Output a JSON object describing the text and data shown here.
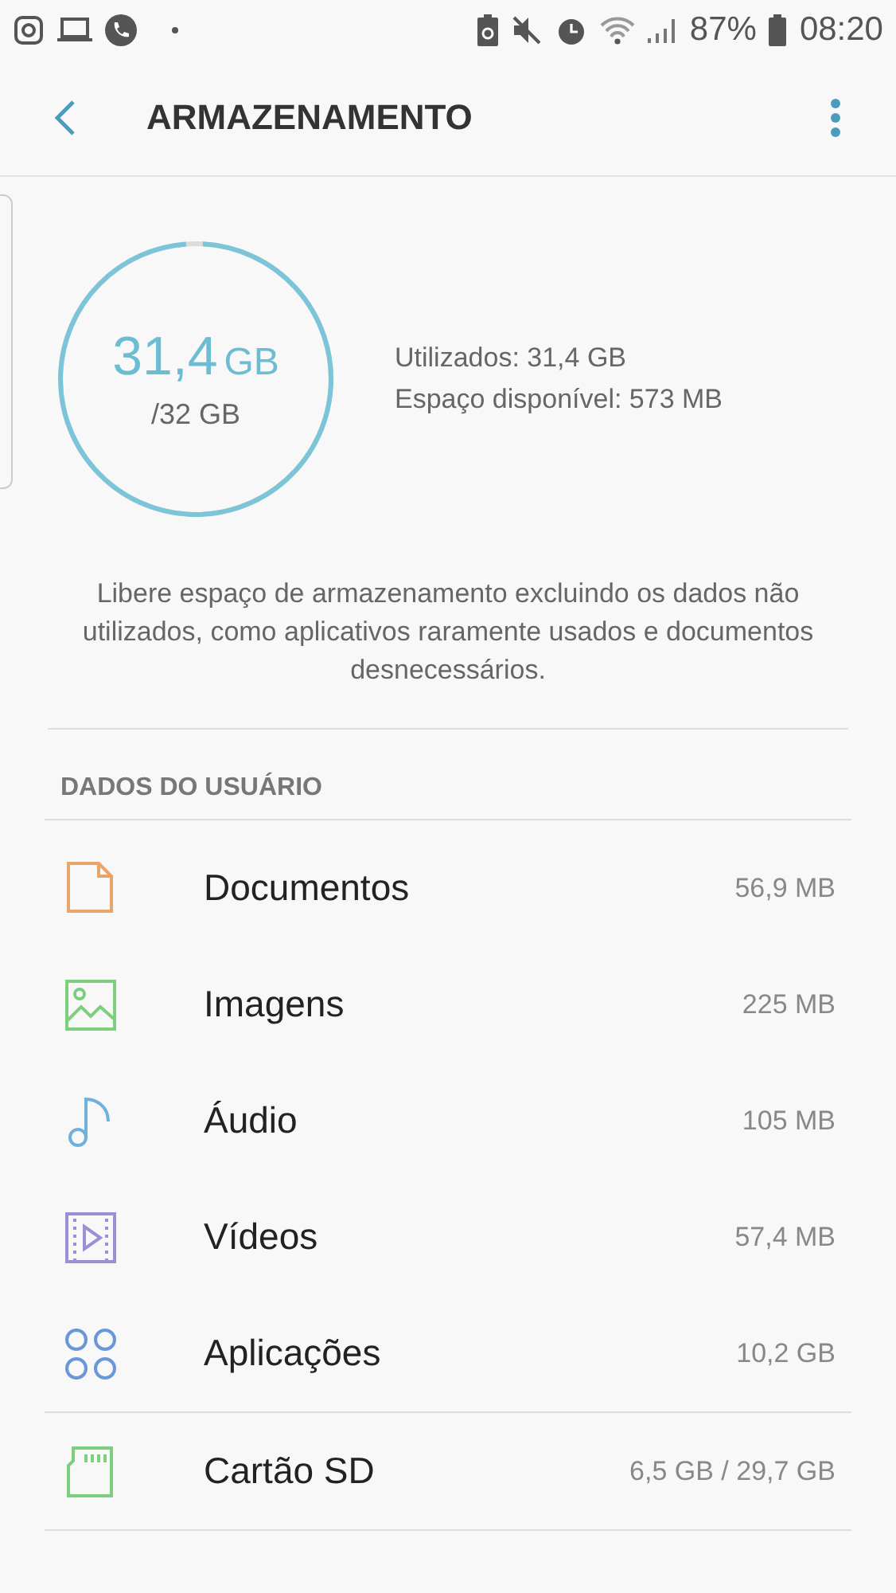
{
  "status_bar": {
    "battery": "87%",
    "time": "08:20"
  },
  "app_bar": {
    "title": "ARMAZENAMENTO"
  },
  "usage": {
    "used": "31,4",
    "unit": "GB",
    "total": "/32 GB",
    "level": 0.98,
    "used_line": "Utilizados: 31,4 GB",
    "free_line": "Espaço disponível: 573 MB"
  },
  "description": "Libere espaço de armazenamento excluindo os dados não utilizados, como aplicativos raramente usados e documentos desnecessários.",
  "section": {
    "title": "DADOS DO USUÁRIO"
  },
  "items": [
    {
      "kind": "document",
      "label": "Documentos",
      "size": "56,9 MB",
      "color": "#e8a56a"
    },
    {
      "kind": "image",
      "label": "Imagens",
      "size": "225 MB",
      "color": "#7ccf7c"
    },
    {
      "kind": "audio",
      "label": "Áudio",
      "size": "105 MB",
      "color": "#6fb0dc"
    },
    {
      "kind": "video",
      "label": "Vídeos",
      "size": "57,4 MB",
      "color": "#9d8fd6"
    },
    {
      "kind": "apps",
      "label": "Aplicações",
      "size": "10,2 GB",
      "color": "#6a97d8"
    }
  ],
  "sd_card": {
    "kind": "sd",
    "label": "Cartão SD",
    "size": "6,5 GB / 29,7 GB",
    "color": "#7ccf7c"
  }
}
